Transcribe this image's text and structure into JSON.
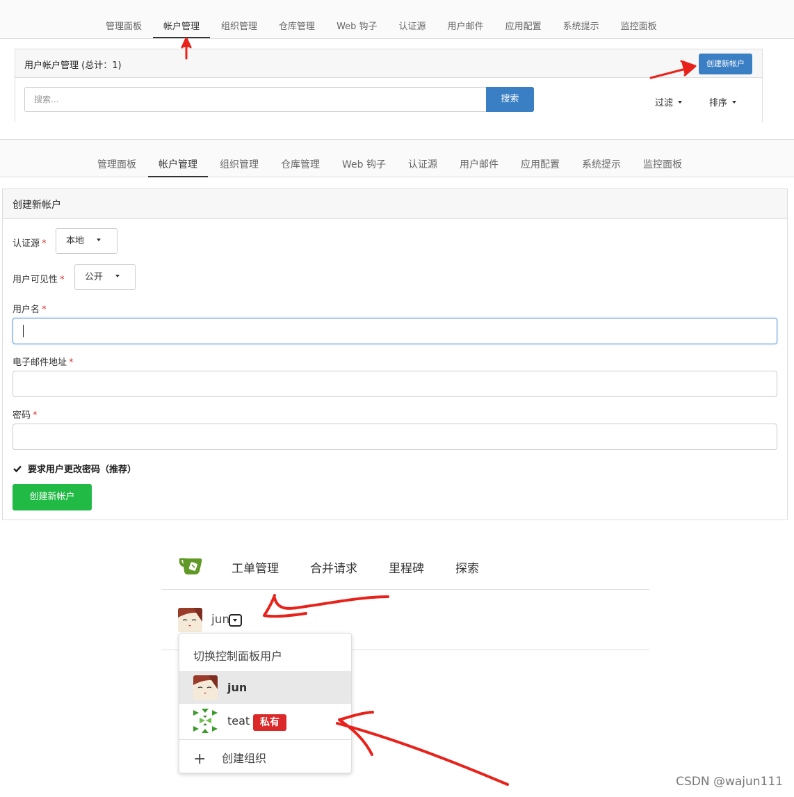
{
  "admin_tabs": [
    "管理面板",
    "帐户管理",
    "组织管理",
    "仓库管理",
    "Web 钩子",
    "认证源",
    "用户邮件",
    "应用配置",
    "系统提示",
    "监控面板"
  ],
  "account_list": {
    "title": "用户帐户管理 (总计：1)",
    "create_button": "创建新帐户",
    "search_placeholder": "搜索...",
    "search_button": "搜索",
    "filter_label": "过滤",
    "sort_label": "排序"
  },
  "create_form": {
    "title": "创建新帐户",
    "auth_source_label": "认证源",
    "auth_source_value": "本地",
    "visibility_label": "用户可见性",
    "visibility_value": "公开",
    "username_label": "用户名",
    "email_label": "电子邮件地址",
    "password_label": "密码",
    "must_change_password_label": "要求用户更改密码（推荐）",
    "must_change_password_checked": true,
    "submit_button": "创建新帐户",
    "required_mark": "*"
  },
  "main_nav": {
    "items": [
      "工单管理",
      "合并请求",
      "里程碑",
      "探索"
    ]
  },
  "context_switcher": {
    "current_user": "jun",
    "menu_title": "切换控制面板用户",
    "options": [
      {
        "name": "jun",
        "selected": true
      },
      {
        "name": "teat",
        "badge": "私有"
      }
    ],
    "create_org_label": "创建组织"
  },
  "watermark": "CSDN @wajun111",
  "colors": {
    "primary_blue": "#3a7ec3",
    "green": "#21ba45",
    "badge_red": "#db2828",
    "annotation_red": "#e8221b",
    "logo_green": "#609926"
  }
}
